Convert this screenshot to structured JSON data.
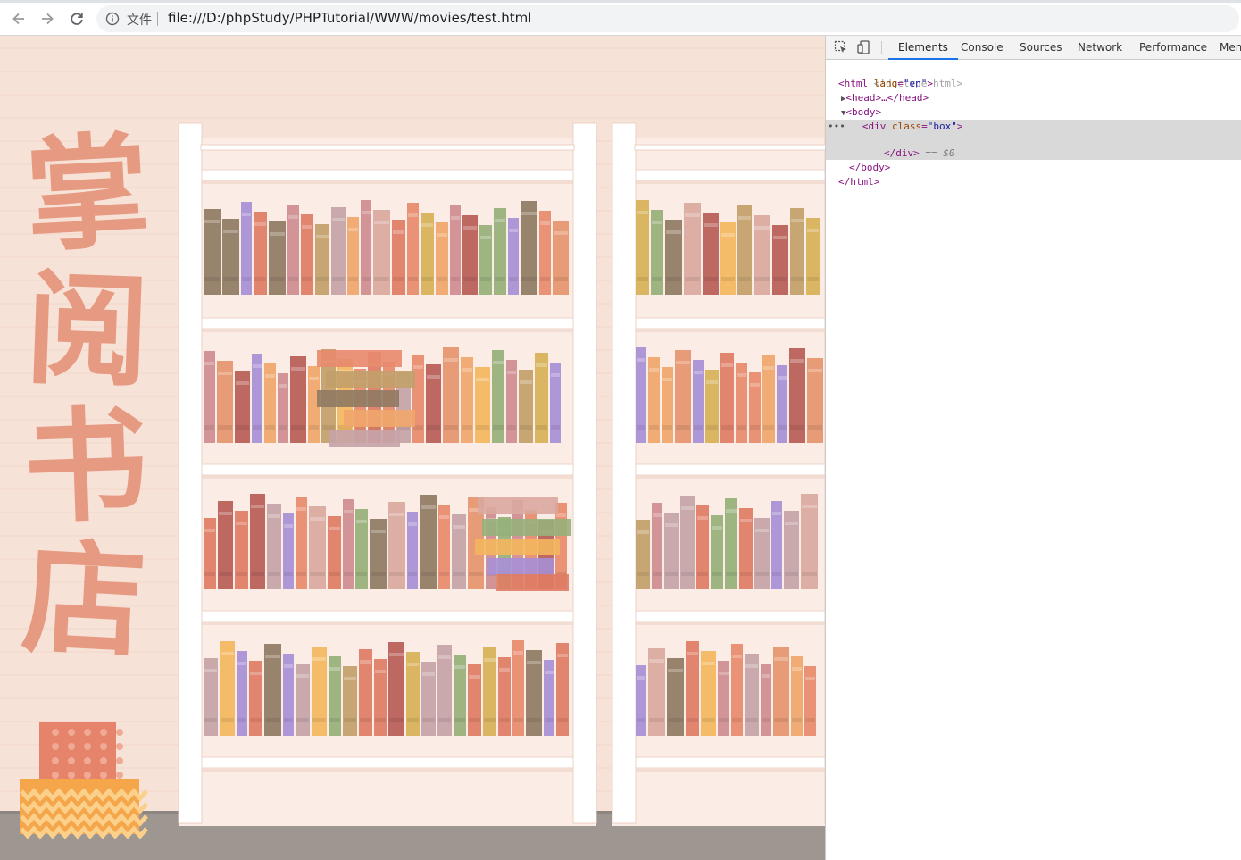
{
  "browser": {
    "scheme_label": "文件",
    "url": "file:///D:/phpStudy/PHPTutorial/WWW/movies/test.html"
  },
  "page": {
    "title_chars": [
      "掌",
      "阅",
      "书",
      "店"
    ],
    "colors": {
      "wall": "#f7e2d8",
      "title": "#e79a82",
      "floor": "#9e9691",
      "shelf": "#ffffff"
    }
  },
  "devtools": {
    "tabs": [
      {
        "label": "Elements",
        "active": true
      },
      {
        "label": "Console",
        "active": false
      },
      {
        "label": "Sources",
        "active": false
      },
      {
        "label": "Network",
        "active": false
      },
      {
        "label": "Performance",
        "active": false
      },
      {
        "label": "Mem",
        "active": false
      }
    ],
    "dom": {
      "doctype": "<!doctype html>",
      "html_open_tag": "<html",
      "html_attr": "lang",
      "html_attr_value": "\"en\"",
      "head": "<head>…</head>",
      "body_open": "<body>",
      "div_open_tag": "<div",
      "div_attr": "class",
      "div_attr_value": "\"box\"",
      "div_close": "</div>",
      "selected_marker": "== $0",
      "body_close": "</body>",
      "html_close": "</html>",
      "dots": "•••"
    }
  }
}
